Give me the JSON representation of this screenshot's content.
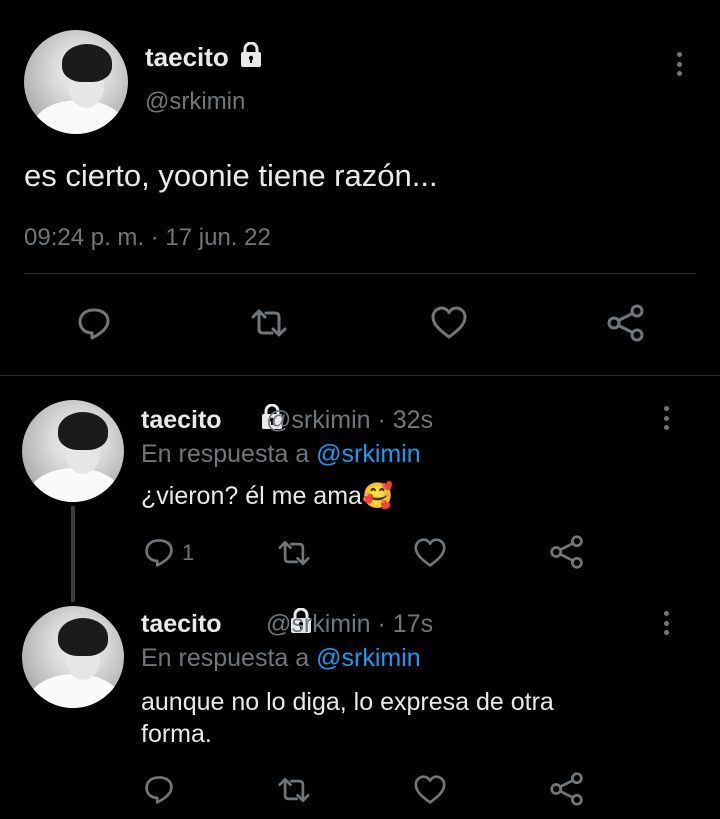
{
  "main_tweet": {
    "display_name": "taecito",
    "handle": "@srkimin",
    "text": "es cierto, yoonie tiene razón...",
    "timestamp": "09:24 p. m. · 17 jun. 22",
    "actions": [
      "reply-icon",
      "retweet-icon",
      "like-icon",
      "share-icon"
    ]
  },
  "replies": [
    {
      "display_name": "taecito",
      "meta": "@srkimin · 32s",
      "reply_prefix": "En respuesta a",
      "reply_to": "@srkimin",
      "text": "¿vieron? él me ama",
      "emoji": "🥰",
      "reply_count": "1"
    },
    {
      "display_name": "taecito",
      "meta": "@srkimin · 17s",
      "reply_prefix": "En respuesta a",
      "reply_to": "@srkimin",
      "text_line1": "aunque no lo diga, lo expresa de otra",
      "text_line2": "forma.",
      "reply_count": ""
    }
  ],
  "colors": {
    "background": "#000000",
    "text": "#e7e9ea",
    "muted": "#71767b",
    "link": "#1d9bf0",
    "divider": "#2f3336"
  }
}
